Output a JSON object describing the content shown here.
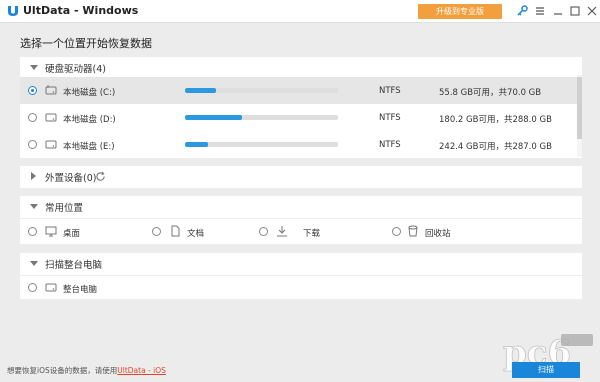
{
  "titlebar": {
    "app_title": "UltData - Windows",
    "upgrade_label": "升级到专业版",
    "icons": [
      "key-icon",
      "menu-icon",
      "minimize-icon",
      "maximize-icon",
      "close-icon"
    ]
  },
  "heading": "选择一个位置开始恢复数据",
  "hard_disks": {
    "title": "硬盘驱动器(4)",
    "rows": [
      {
        "name": "本地磁盘 (C:)",
        "fs": "NTFS",
        "size_text": "55.8 GB可用，共70.0 GB",
        "used_fraction": 0.2,
        "selected": true
      },
      {
        "name": "本地磁盘 (D:)",
        "fs": "NTFS",
        "size_text": "180.2 GB可用，共288.0 GB",
        "used_fraction": 0.37,
        "selected": false
      },
      {
        "name": "本地磁盘 (E:)",
        "fs": "NTFS",
        "size_text": "242.4 GB可用，共287.0 GB",
        "used_fraction": 0.15,
        "selected": false
      }
    ]
  },
  "external": {
    "title": "外置设备(0)"
  },
  "common": {
    "title": "常用位置",
    "items": [
      {
        "label": "桌面",
        "icon": "monitor-icon"
      },
      {
        "label": "文档",
        "icon": "document-icon"
      },
      {
        "label": "下载",
        "icon": "download-icon"
      },
      {
        "label": "回收站",
        "icon": "recycle-bin-icon"
      }
    ]
  },
  "full_scan": {
    "title": "扫描整台电脑",
    "item_label": "整台电脑"
  },
  "footer": {
    "text": "想要恢复iOS设备的数据，请使用",
    "link": "UltData - iOS"
  },
  "scan_button": "扫描",
  "colors": {
    "accent": "#1a86d9",
    "upgrade": "#f2a03d",
    "link": "#e0452b"
  }
}
